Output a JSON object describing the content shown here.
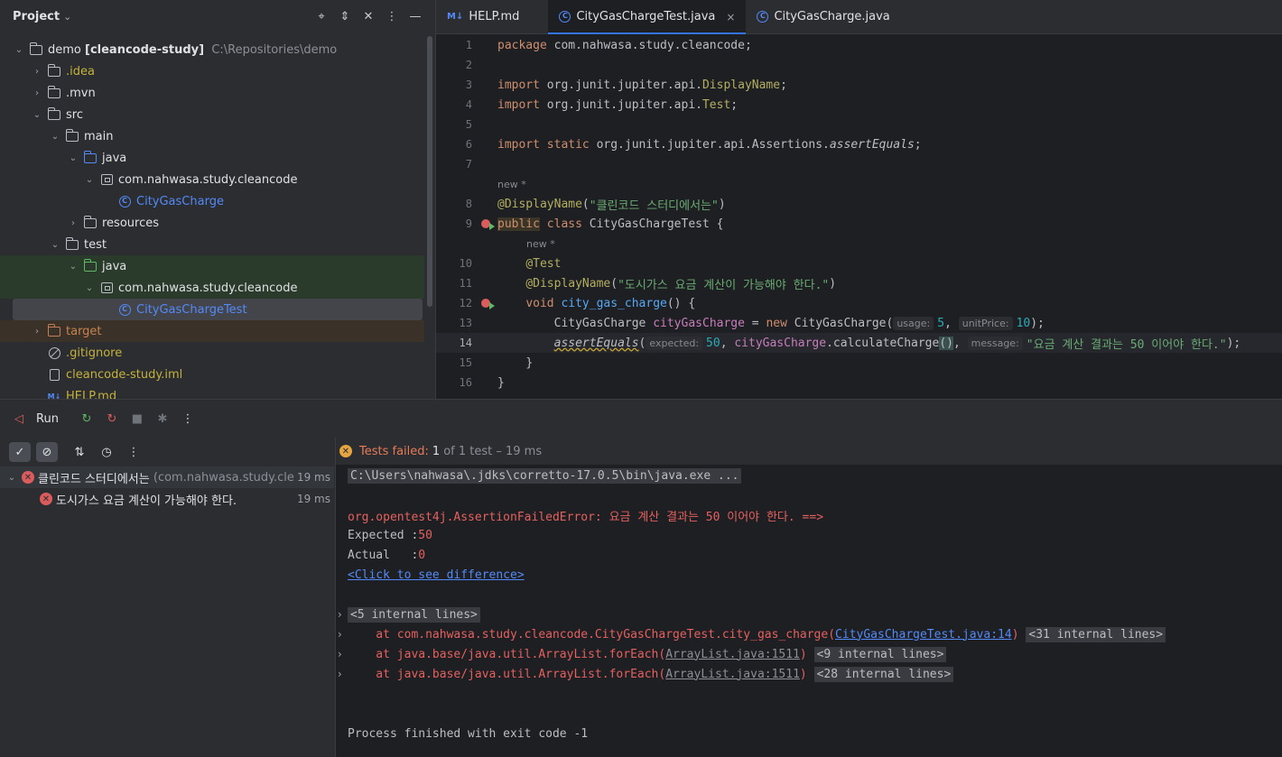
{
  "project": {
    "title": "Project",
    "tree": [
      {
        "label": "demo",
        "bold": "[cleancode-study]",
        "path": "C:\\Repositories\\demo"
      },
      {
        "label": ".idea"
      },
      {
        "label": ".mvn"
      },
      {
        "label": "src"
      },
      {
        "label": "main"
      },
      {
        "label": "java"
      },
      {
        "label": "com.nahwasa.study.cleancode"
      },
      {
        "label": "CityGasCharge"
      },
      {
        "label": "resources"
      },
      {
        "label": "test"
      },
      {
        "label": "java"
      },
      {
        "label": "com.nahwasa.study.cleancode"
      },
      {
        "label": "CityGasChargeTest"
      },
      {
        "label": "target"
      },
      {
        "label": ".gitignore"
      },
      {
        "label": "cleancode-study.iml"
      },
      {
        "label": "HELP.md"
      }
    ]
  },
  "editor": {
    "tabs": [
      {
        "icon": "M↓",
        "label": "HELP.md"
      },
      {
        "label": "CityGasChargeTest.java",
        "close": "×"
      },
      {
        "label": "CityGasCharge.java"
      }
    ],
    "hint_new": "new *",
    "lines": {
      "l1": {
        "n": "1",
        "kw": "package",
        "rest": " com.nahwasa.study.cleancode;"
      },
      "l2": {
        "n": "2"
      },
      "l3": {
        "n": "3",
        "kw": "import",
        "pre": " org.junit.jupiter.api.",
        "cls": "DisplayName",
        "post": ";"
      },
      "l4": {
        "n": "4",
        "kw": "import",
        "pre": " org.junit.jupiter.api.",
        "cls": "Test",
        "post": ";"
      },
      "l5": {
        "n": "5"
      },
      "l6": {
        "n": "6",
        "kw": "import static",
        "pre": " org.junit.jupiter.api.Assertions.",
        "cls": "assertEquals",
        "post": ";"
      },
      "l7": {
        "n": "7"
      },
      "l8": {
        "n": "8",
        "ann": "@DisplayName",
        "open": "(",
        "str": "\"클린코드 스터디에서는\"",
        "close": ")"
      },
      "l9": {
        "n": "9",
        "kw1": "public",
        "kw2": "class",
        "name": " CityGasChargeTest {"
      },
      "l10": {
        "n": "10",
        "ann": "@Test"
      },
      "l11": {
        "n": "11",
        "ann": "@DisplayName",
        "open": "(",
        "str": "\"도시가스 요금 계산이 가능해야 한다.\"",
        "close": ")"
      },
      "l12": {
        "n": "12",
        "kw": "void",
        "fn": " city_gas_charge",
        "rest": "() {"
      },
      "l13": {
        "n": "13",
        "type": "CityGasCharge ",
        "var": "cityGasCharge",
        "eq": " = ",
        "kw": "new",
        "ctor": " CityGasCharge(",
        "h1": "usage:",
        "v1": "5",
        "sep": ", ",
        "h2": "unitPrice:",
        "v2": "10",
        "end": ");"
      },
      "l14": {
        "n": "14",
        "fn": "assertEquals",
        "open": "(",
        "h1": "expected:",
        "v1": "50",
        "sep1": ", ",
        "var": "cityGasCharge",
        "dot": ".",
        "call": "calculateCharge",
        "paren": "()",
        "sep2": ", ",
        "h2": "message:",
        "str": "\"요금 계산 결과는 50 이어야 한다.\"",
        "end": ");"
      },
      "l15": {
        "n": "15",
        "t": "}"
      },
      "l16": {
        "n": "16",
        "t": "}"
      }
    }
  },
  "run": {
    "title": "Run",
    "status_prefix": "Tests failed:",
    "status_count": "1",
    "status_rest": "of 1 test – 19 ms",
    "tests": [
      {
        "name": "클린코드 스터디에서는",
        "pkg": "(com.nahwasa.study.cle",
        "dur": "19 ms"
      },
      {
        "name": "도시가스 요금 계산이 가능해야 한다.",
        "dur": "19 ms"
      }
    ],
    "console": {
      "cmd": "C:\\Users\\nahwasa\\.jdks\\corretto-17.0.5\\bin\\java.exe ...",
      "error": "org.opentest4j.AssertionFailedError: 요금 계산 결과는 50 이어야 한다. ==>",
      "expected_label": "Expected :",
      "expected_val": "50",
      "actual_label": "Actual   :",
      "actual_val": "0",
      "diff_link": "<Click to see difference>",
      "internal5": "<5 internal lines>",
      "at1": "    at com.nahwasa.study.cleancode.CityGasChargeTest.city_gas_charge(",
      "at1_link": "CityGasChargeTest.java:14",
      "at1_end": ")",
      "internal31": "<31 internal lines>",
      "at2": "    at java.base/java.util.ArrayList.forEach(",
      "at2_link": "ArrayList.java:1511",
      "at2_end": ")",
      "internal9": "<9 internal lines>",
      "at3": "    at java.base/java.util.ArrayList.forEach(",
      "at3_link": "ArrayList.java:1511",
      "at3_end": ")",
      "internal28": "<28 internal lines>",
      "finished": "Process finished with exit code -1"
    }
  },
  "colors": {
    "accent": "#3574f0",
    "error": "#db5c5c",
    "string": "#6aab73",
    "keyword": "#cf8e6d"
  }
}
